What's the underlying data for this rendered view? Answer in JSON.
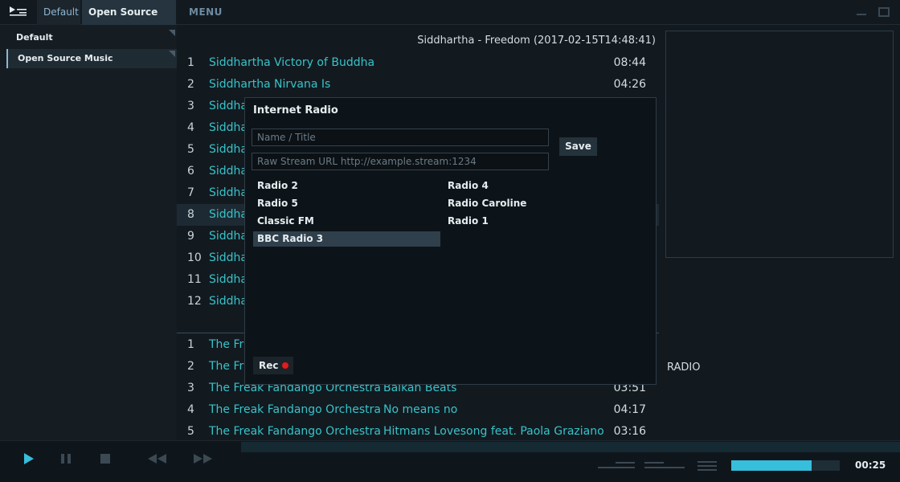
{
  "header": {
    "tabs": [
      {
        "label": "Default"
      },
      {
        "label": "Open Source Music"
      }
    ],
    "menu_label": "MENU"
  },
  "sidebar": {
    "items": [
      {
        "label": "Default"
      },
      {
        "label": "Open Source Music"
      }
    ]
  },
  "now_playing": "Siddhartha - Freedom (2017-02-15T14:48:41)",
  "playlist_top": [
    {
      "num": "1",
      "artist": "Siddhartha",
      "title": "Victory of Buddha",
      "duration": "08:44"
    },
    {
      "num": "2",
      "artist": "Siddhartha",
      "title": "Nirvana Is",
      "duration": "04:26"
    },
    {
      "num": "3",
      "artist": "Siddha"
    },
    {
      "num": "4",
      "artist": "Siddha"
    },
    {
      "num": "5",
      "artist": "Siddha"
    },
    {
      "num": "6",
      "artist": "Siddha"
    },
    {
      "num": "7",
      "artist": "Siddha"
    },
    {
      "num": "8",
      "artist": "Siddha"
    },
    {
      "num": "9",
      "artist": "Siddha"
    },
    {
      "num": "10",
      "artist": "Siddha"
    },
    {
      "num": "11",
      "artist": "Siddha"
    },
    {
      "num": "12",
      "artist": "Siddha"
    }
  ],
  "playlist_bottom": [
    {
      "num": "1",
      "artist": "The Fr"
    },
    {
      "num": "2",
      "artist": "The Fr"
    },
    {
      "num": "3",
      "artist": "The Freak Fandango Orchestra",
      "title": "Balkan Beats",
      "duration": "03:51"
    },
    {
      "num": "4",
      "artist": "The Freak Fandango Orchestra",
      "title": "No means no",
      "duration": "04:17"
    },
    {
      "num": "5",
      "artist": "The Freak Fandango Orchestra",
      "title": "Hitmans Lovesong feat. Paola Graziano",
      "duration": "03:16"
    }
  ],
  "right_panel": {
    "radio_label": "RADIO"
  },
  "dialog": {
    "title": "Internet Radio",
    "name_placeholder": "Name / Title",
    "url_placeholder": "Raw Stream URL http://example.stream:1234",
    "save_label": "Save",
    "stations_left": [
      "Radio 2",
      "Radio 5",
      "Classic FM",
      "BBC Radio 3"
    ],
    "stations_right": [
      "Radio 4",
      "Radio Caroline",
      "Radio 1"
    ],
    "selected_station": "BBC Radio 3",
    "rec_label": "Rec"
  },
  "player": {
    "time": "00:25",
    "volume": 0.74,
    "accent_color": "#36bedc",
    "rec_color": "#e21b1b",
    "link_color": "#38c3c9"
  }
}
